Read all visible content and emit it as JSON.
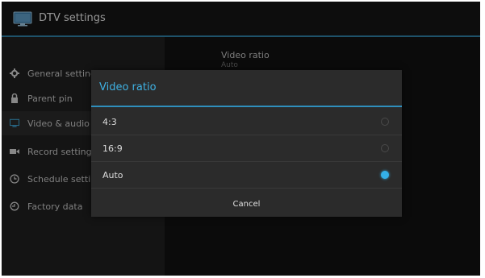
{
  "app": {
    "title": "DTV settings"
  },
  "sidebar": {
    "items": [
      {
        "label": "General settings",
        "icon": "gear-icon"
      },
      {
        "label": "Parent pin",
        "icon": "lock-icon"
      },
      {
        "label": "Video & audio",
        "icon": "monitor-icon",
        "active": true
      },
      {
        "label": "Record settings",
        "icon": "camera-icon"
      },
      {
        "label": "Schedule settings",
        "icon": "clock-icon"
      },
      {
        "label": "Factory data",
        "icon": "history-icon"
      }
    ]
  },
  "content": {
    "title": "Video ratio",
    "subtitle": "Auto"
  },
  "dialog": {
    "title": "Video ratio",
    "options": [
      {
        "label": "4:3",
        "checked": false
      },
      {
        "label": "16:9",
        "checked": false
      },
      {
        "label": "Auto",
        "checked": true
      }
    ],
    "cancel_label": "Cancel"
  },
  "colors": {
    "accent": "#34b0e8",
    "title_accent": "#3fb1e3",
    "rule": "#2f7ea3"
  }
}
